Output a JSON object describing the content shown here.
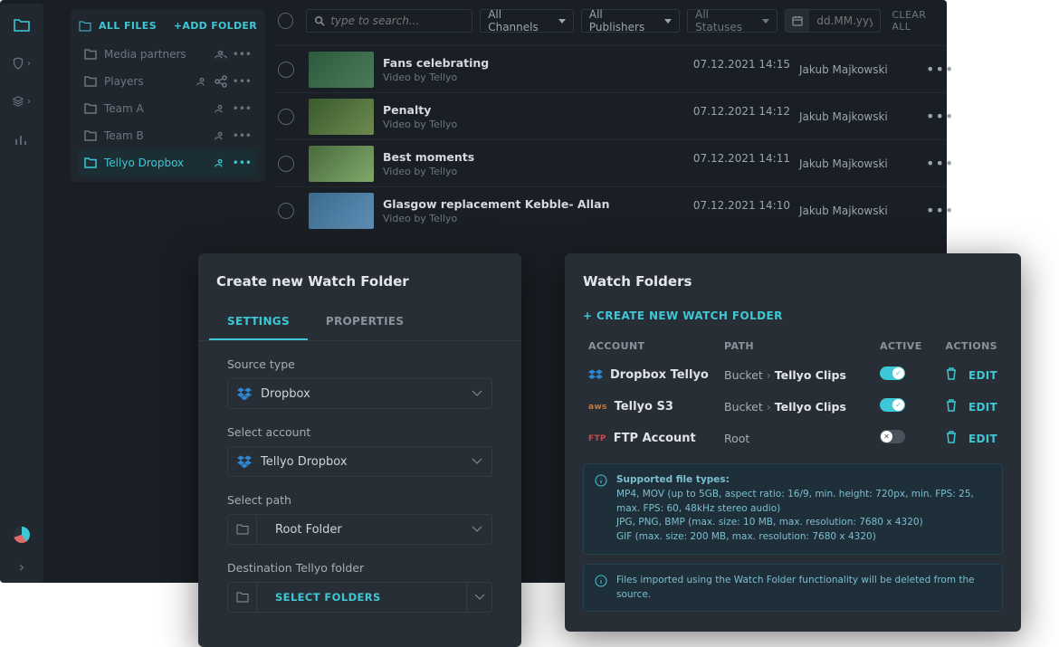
{
  "folders": {
    "all_label": "ALL FILES",
    "add_label": "+ADD FOLDER",
    "items": [
      {
        "label": "Media partners"
      },
      {
        "label": "Players"
      },
      {
        "label": "Team A"
      },
      {
        "label": "Team B"
      },
      {
        "label": "Tellyo Dropbox"
      }
    ]
  },
  "filters": {
    "search_placeholder": "type to search...",
    "channels": "All Channels",
    "publishers": "All Publishers",
    "statuses": "All Statuses",
    "date_placeholder": "dd.MM.yyyy",
    "clear": "CLEAR ALL"
  },
  "media": [
    {
      "title": "Fans celebrating",
      "sub": "Video by Tellyo",
      "date": "07.12.2021 14:15",
      "user": "Jakub Majkowski"
    },
    {
      "title": "Penalty",
      "sub": "Video by Tellyo",
      "date": "07.12.2021 14:12",
      "user": "Jakub Majkowski"
    },
    {
      "title": "Best moments",
      "sub": "Video by Tellyo",
      "date": "07.12.2021 14:11",
      "user": "Jakub Majkowski"
    },
    {
      "title": "Glasgow replacement Kebble- Allan",
      "sub": "Video by Tellyo",
      "date": "07.12.2021 14:10",
      "user": "Jakub Majkowski"
    }
  ],
  "create_modal": {
    "title": "Create new Watch Folder",
    "tabs": {
      "settings": "SETTINGS",
      "properties": "PROPERTIES"
    },
    "source_type_label": "Source type",
    "source_type_value": "Dropbox",
    "account_label": "Select account",
    "account_value": "Tellyo Dropbox",
    "path_label": "Select path",
    "path_value": "Root Folder",
    "dest_label": "Destination Tellyo folder",
    "dest_value": "SELECT FOLDERS"
  },
  "watch_modal": {
    "title": "Watch Folders",
    "create": "+ CREATE NEW WATCH FOLDER",
    "head": {
      "account": "ACCOUNT",
      "path": "PATH",
      "active": "ACTIVE",
      "actions": "ACTIONS"
    },
    "rows": [
      {
        "account": "Dropbox Tellyo",
        "path_a": "Bucket",
        "path_b": "Tellyo Clips",
        "active": true,
        "icon": "dropbox"
      },
      {
        "account": "Tellyo S3",
        "path_a": "Bucket",
        "path_b": "Tellyo Clips",
        "active": true,
        "icon": "aws"
      },
      {
        "account": "FTP Account",
        "path_a": "Root",
        "path_b": "",
        "active": false,
        "icon": "ftp"
      }
    ],
    "edit": "EDIT",
    "tip1_title": "Supported file types:",
    "tip1_a": "MP4, MOV (up to 5GB, aspect ratio: 16/9, min. height: 720px, min. FPS: 25, max. FPS: 60, 48kHz stereo audio)",
    "tip1_b": "JPG, PNG, BMP (max. size: 10 MB, max. resolution: 7680 x 4320)",
    "tip1_c": "GIF (max. size: 200 MB, max. resolution: 7680 x 4320)",
    "tip2": "Files imported using the Watch Folder functionality will be deleted from the source."
  }
}
